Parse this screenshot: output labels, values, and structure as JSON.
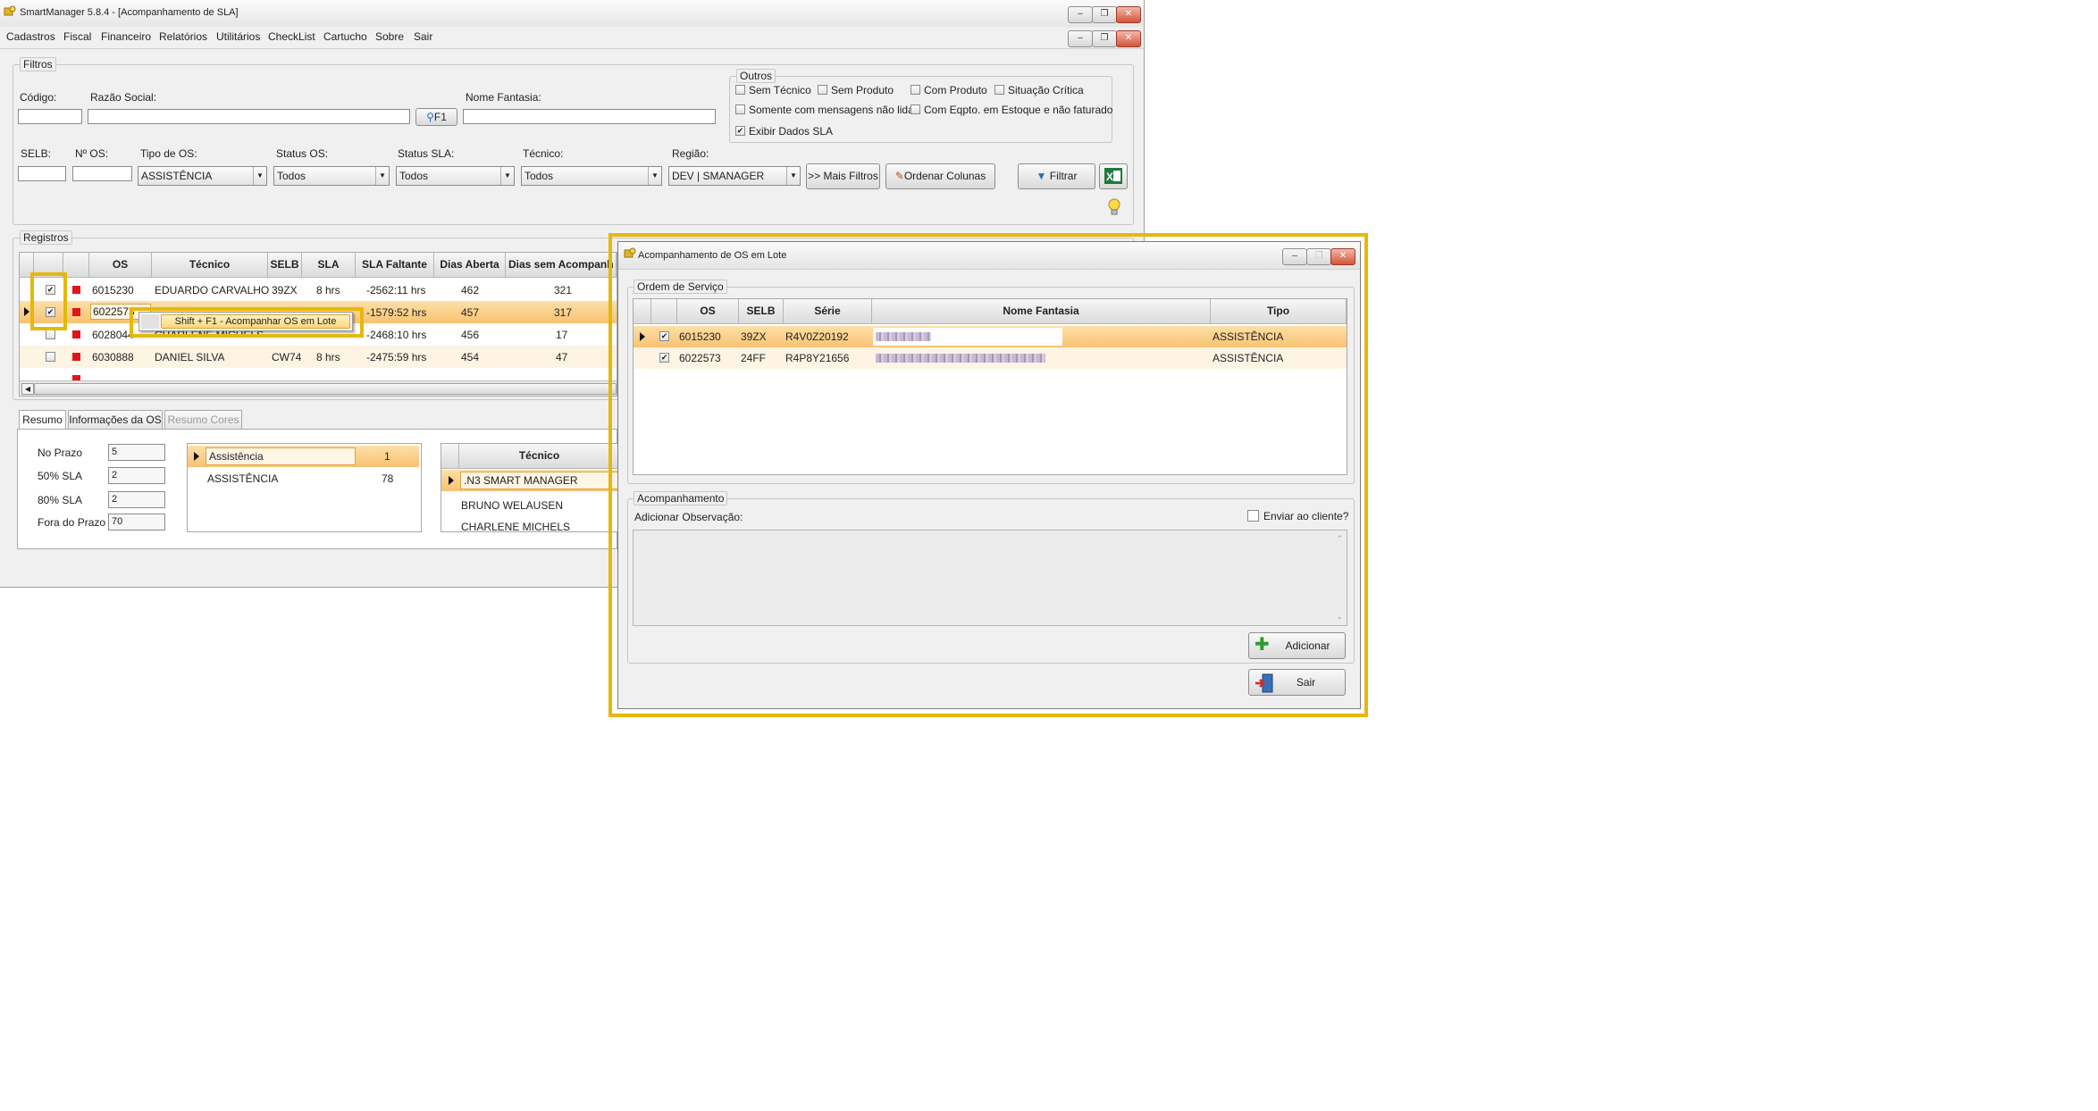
{
  "window": {
    "title": "SmartManager 5.8.4 - [Acompanhamento de SLA]",
    "min": "–",
    "max": "❐",
    "close": "✕"
  },
  "menu": [
    "Cadastros",
    "Fiscal",
    "Financeiro",
    "Relatórios",
    "Utilitários",
    "CheckList",
    "Cartucho",
    "Sobre",
    "Sair"
  ],
  "filtros": {
    "legend": "Filtros",
    "codigo_label": "Código:",
    "razao_label": "Razão Social:",
    "f1_label": "F1",
    "fantasia_label": "Nome Fantasia:",
    "selb_label": "SELB:",
    "nos_label": "Nº OS:",
    "tipo_label": "Tipo de OS:",
    "tipo_value": "ASSISTÊNCIA",
    "status_os_label": "Status OS:",
    "status_os_value": "Todos",
    "status_sla_label": "Status SLA:",
    "status_sla_value": "Todos",
    "tecnico_label": "Técnico:",
    "tecnico_value": "Todos",
    "regiao_label": "Região:",
    "regiao_value": "DEV | SMANAGER",
    "mais_filtros": ">> Mais Filtros",
    "ordenar_colunas": "Ordenar Colunas",
    "filtrar": "Filtrar"
  },
  "outros": {
    "legend": "Outros",
    "sem_tecnico": "Sem Técnico",
    "sem_produto": "Sem Produto",
    "com_produto": "Com Produto",
    "situacao_critica": "Situação Crítica",
    "somente_msgs": "Somente com mensagens não lidas",
    "com_eqpto": "Com Eqpto. em Estoque e não faturado",
    "exibir_sla": "Exibir Dados SLA",
    "check_mark": "✔"
  },
  "registros": {
    "legend": "Registros",
    "headers": [
      "OS",
      "Técnico",
      "SELB",
      "SLA",
      "SLA Faltante",
      "Dias Aberta",
      "Dias sem Acompanh"
    ],
    "rows": [
      {
        "os": "6015230",
        "tecnico": "EDUARDO CARVALHO",
        "selb": "39ZX",
        "sla": "8 hrs",
        "faltante": "-2562:11 hrs",
        "dias": "462",
        "sem": "321"
      },
      {
        "os": "6022573",
        "tecnico": "",
        "selb": "",
        "sla": "",
        "faltante": "-1579:52 hrs",
        "dias": "457",
        "sem": "317"
      },
      {
        "os": "6028044",
        "tecnico": "CHARLENE MICHELS",
        "selb": "",
        "sla": "",
        "faltante": "-2468:10 hrs",
        "dias": "456",
        "sem": "17"
      },
      {
        "os": "6030888",
        "tecnico": "DANIEL SILVA",
        "selb": "CW74",
        "sla": "8 hrs",
        "faltante": "-2475:59 hrs",
        "dias": "454",
        "sem": "47"
      },
      {
        "os": "",
        "tecnico": "",
        "selb": "",
        "sla": "",
        "faltante": "",
        "dias": "",
        "sem": ""
      }
    ],
    "context_menu": "Shift + F1 - Acompanhar OS em Lote"
  },
  "tabs": [
    "Resumo",
    "Informações da OS",
    "Resumo Cores"
  ],
  "resumo": {
    "no_prazo_label": "No Prazo",
    "no_prazo": "5",
    "p50_label": "50% SLA",
    "p50": "2",
    "p80_label": "80% SLA",
    "p80": "2",
    "fora_label": "Fora do Prazo",
    "fora": "70",
    "tipos": [
      {
        "name": "Assistência",
        "count": "1"
      },
      {
        "name": "ASSISTÊNCIA",
        "count": "78"
      }
    ],
    "tecnico_header": "Técnico",
    "tecnicos": [
      ".N3 SMART MANAGER",
      "BRUNO WELAUSEN",
      "CHARLENE MICHELS"
    ]
  },
  "dialog": {
    "title": "Acompanhamento de OS em Lote",
    "os_legend": "Ordem de Serviço",
    "headers": [
      "OS",
      "SELB",
      "Série",
      "Nome Fantasia",
      "Tipo"
    ],
    "rows": [
      {
        "os": "6015230",
        "selb": "39ZX",
        "serie": "R4V0Z20192",
        "tipo": "ASSISTÊNCIA"
      },
      {
        "os": "6022573",
        "selb": "24FF",
        "serie": "R4P8Y21656",
        "tipo": "ASSISTÊNCIA"
      }
    ],
    "acomp_legend": "Acompanhamento",
    "obs_label": "Adicionar Observação:",
    "enviar_label": "Enviar ao cliente?",
    "adicionar": "Adicionar",
    "sair": "Sair"
  },
  "colors": {
    "highlight": "#e5b80b",
    "row_selected": "#f8c271",
    "status_red": "#e2141a"
  }
}
